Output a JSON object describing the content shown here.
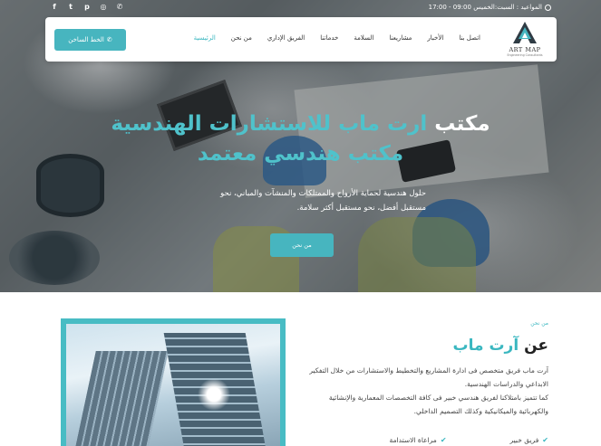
{
  "topbar": {
    "hours_text": "المواعيد : السبت:الخميس 09:00 - 17:00",
    "socials": [
      "facebook-icon",
      "twitter-icon",
      "pinterest-icon",
      "instagram-icon",
      "whatsapp-icon"
    ],
    "social_glyphs": [
      "f",
      "t",
      "p",
      "◎",
      "✆"
    ]
  },
  "logo": {
    "name": "ART MAP",
    "subtitle": "Engineering Consultants"
  },
  "nav": {
    "items": [
      "الرئيسية",
      "من نحن",
      "الفريق الإداري",
      "خدماتنا",
      "السلامة",
      "مشاريعنا",
      "الأخبار",
      "اتصل بنا"
    ],
    "hotline_label": "الخط الساخن"
  },
  "hero": {
    "title_prefix": "مكتب ",
    "title_brand": "ارت ماب",
    "title_suffix": " للاستشارات الهندسية",
    "subtitle": "مكتب هندسي معتمد",
    "description": "حلول هندسية لحماية الأرواح والممتلكات والمنشآت والمباني، نحو مستقبل أفضل، نحو مستقبل أكثر سلامة.",
    "cta_label": "من نحن"
  },
  "about": {
    "kicker": "من نحن",
    "title_prefix": "عن ",
    "title_brand": "آرت ماب",
    "text_1": "آرت ماب فريق متخصص فى ادارة المشاريع والتخطيط والاستشارات من خلال التفكير الابداعي والدراسات الهندسية.",
    "text_2": "كما تتميز بامتلاكنا لفريق هندسي خبير فى كافة التخصصات المعمارية والإنشائية والكهربائية والميكانيكية وكذلك التصميم الداخلي.",
    "features": [
      "فريق خبير",
      "مراعاة الاستدامة"
    ]
  },
  "colors": {
    "accent": "#47b5bf",
    "accent_text": "#4fc2cb"
  }
}
